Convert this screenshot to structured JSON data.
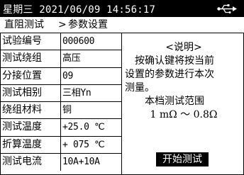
{
  "status": {
    "datetime": "星期三 2021/06/09 14:56:17",
    "usb_icon": "usb-icon"
  },
  "breadcrumb": {
    "parent": "直阻测试",
    "separator": ">",
    "current": "参数设置"
  },
  "params": [
    {
      "label": "试验编号",
      "value": "000600"
    },
    {
      "label": "测试绕组",
      "value": "高压"
    },
    {
      "label": "分接位置",
      "value": "09"
    },
    {
      "label": "测试相别",
      "value": "三相Yn"
    },
    {
      "label": "绕组材料",
      "value": "铜"
    },
    {
      "label": "测试温度",
      "value": "+25.0 ℃"
    },
    {
      "label": "折算温度",
      "value": "+ 075 ℃"
    },
    {
      "label": "测试电流",
      "value": "10A+10A"
    }
  ],
  "help": {
    "title": "<说明>",
    "line1": "按确认键将按当前",
    "line2": "设置的参数进行本次",
    "line3": "测量。",
    "line4": "本档测试范围",
    "range": "1 mΩ ～ 0.8Ω"
  },
  "actions": {
    "start_label": "开始测试"
  },
  "colors": {
    "background": "#ffffff",
    "foreground": "#000000",
    "status_bar": "#000000"
  }
}
